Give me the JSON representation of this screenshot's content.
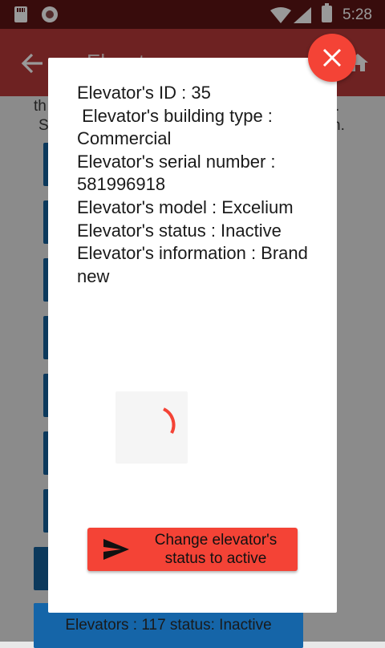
{
  "status_bar": {
    "time": "5:28"
  },
  "app_bar": {
    "title": "Elevat"
  },
  "background": {
    "text_line_1_left": "th",
    "text_line_1_right": ".",
    "text_line_2_left": "S",
    "text_line_2_right": "n.",
    "bottom_button": "Elevators : 117 status: Inactive"
  },
  "dialog": {
    "lines": [
      "Elevator's ID : 35",
      " Elevator's building type : Commercial",
      "Elevator's serial number : 581996918",
      "Elevator's model : Excelium",
      "Elevator's status : Inactive",
      "Elevator's information : Brand new"
    ],
    "action_button": "Change elevator's status to active"
  },
  "colors": {
    "accent": "#f44336",
    "app_bar": "#b71c1c",
    "button_blue": "#2196F3"
  }
}
